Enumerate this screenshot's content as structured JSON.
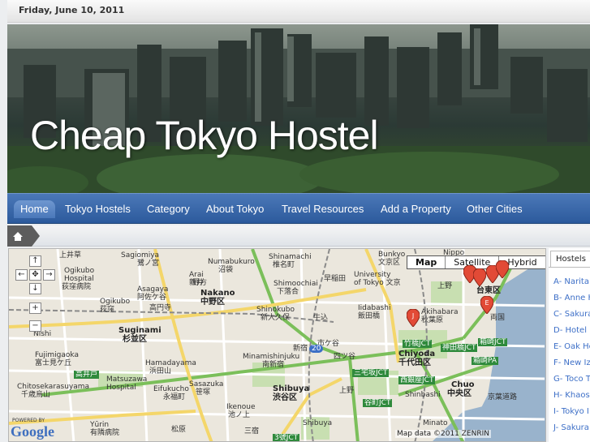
{
  "header": {
    "date": "Friday, June 10, 2011",
    "blog_title": "Cheap Tokyo Hostel"
  },
  "nav": {
    "items": [
      {
        "label": "Home",
        "active": true
      },
      {
        "label": "Tokyo Hostels"
      },
      {
        "label": "Category"
      },
      {
        "label": "About Tokyo"
      },
      {
        "label": "Travel Resources"
      },
      {
        "label": "Add a Property"
      },
      {
        "label": "Other Cities"
      }
    ]
  },
  "breadcrumb": {
    "icon": "home-icon"
  },
  "map": {
    "types": [
      "Map",
      "Satellite",
      "Hybrid"
    ],
    "selected_type": "Map",
    "attribution": "Map data ©2011 ZENRIN",
    "logo": "Google",
    "powered_by": "POWERED BY",
    "labels": {
      "kamiigusa": "上井草",
      "sagamiomiya": "Sagiomiya",
      "saginomiya_jp": "鷺ノ宮",
      "numabukuro": "Numabukuro",
      "numabukuro_jp": "沼袋",
      "shinamachi": "Shinamachi",
      "shinamachi_jp": "椎名町",
      "bunkyo": "Bunkyo",
      "bunkyo_jp": "文京区",
      "ogikubo_hosp": "Ogikubo",
      "ogikubo_hosp2": "Hospital",
      "ogikubo_hosp_jp": "荻窪病院",
      "arai": "Arai",
      "arai_jp": "新井",
      "shimoochiai": "Shimoochiai",
      "shimoochiai_jp": "下落合",
      "waseda": "早稲田",
      "nakano": "Nakano",
      "nakano_jp": "中野区",
      "asagaya": "Asagaya",
      "asagaya_jp": "阿佐ケ谷",
      "nogata": "野方",
      "ogikubo": "Ogikubo",
      "ogikubo_jp": "荻窪",
      "koenji": "高円寺",
      "shinokubo": "Shinokubo",
      "shinokubo_jp": "新大久保",
      "iidabashi": "Iidabashi",
      "iidabashi_jp": "飯田橋",
      "ushigome": "牛込",
      "suginami": "Suginami",
      "suginami_jp": "杉並区",
      "nishi": "Nishi",
      "ichigaya": "市ケ谷",
      "yotsuya": "四ツ谷",
      "minamishinjuku": "Minamishinjuku",
      "minamishinjuku_jp": "南新宿",
      "shinjuku": "新宿",
      "fujimigaoka": "Fujimigaoka",
      "fujimigaoka_jp": "富士見ケ丘",
      "hamadayama": "Hamadayama",
      "hamadayama_jp": "浜田山",
      "takaido": "高井戸",
      "chitosekarasuyama": "Chitosekarasuyama",
      "chitosekarasuyama_jp": "千歳烏山",
      "matsuzawa_hosp": "Matsuzawa",
      "matsuzawa_hosp2": "Hospital",
      "eifukucho": "Eifukucho",
      "eifukucho_jp": "永福町",
      "sasazuka": "Sasazuka",
      "sasazuka_jp": "笹塚",
      "shibuya": "Shibuya",
      "shibuya_jp": "渋谷区",
      "ikenoue": "Ikenoue",
      "ikenoue_jp": "池ノ上",
      "chiyoda": "Chiyoda",
      "chiyoda_jp": "千代田区",
      "chuo": "Chuo",
      "chuo_jp": "中央区",
      "shinbashi": "Shinbashi",
      "akihabara": "Akihabara",
      "akihabara_jp": "秋葉原",
      "ueno": "上野",
      "taito_jp": "台東区",
      "ryogoku": "両国",
      "univ_tokyo": "University",
      "univ_tokyo2": "of Tokyo 文京",
      "takebashi": "竹橋JCT",
      "kandabashi": "神田橋JCT",
      "sansei": "三宅坂JCT",
      "nishiginza": "西銀座JCT",
      "tanimachi": "谷町JCT",
      "hakozaki": "箱崎JCT",
      "hakozaki_pa": "箱崎PA",
      "keiyo": "京葉道路",
      "ueno_street": "上野",
      "yuriin": "Yūrin",
      "yuriin_jp": "有隣病院",
      "showa": "松原",
      "sanjo": "三宿",
      "minato": "Minato",
      "shibuya2": "Shibuya",
      "jct3": "3號JCT",
      "route20": "20",
      "nipp": "Nippo"
    }
  },
  "hostels": {
    "tab_label": "Hostels",
    "items": [
      "A- Narita",
      "B- Anne H",
      "C- Sakura",
      "D- Hotel N",
      "E- Oak Ho",
      "F- New Iz",
      "G- Toco T",
      "H- Khaos",
      "I- Tokyo I",
      "J- Sakura"
    ]
  },
  "colors": {
    "nav_bg": "#3a68aa",
    "link": "#3d6fc7",
    "pin": "#e24a36"
  }
}
